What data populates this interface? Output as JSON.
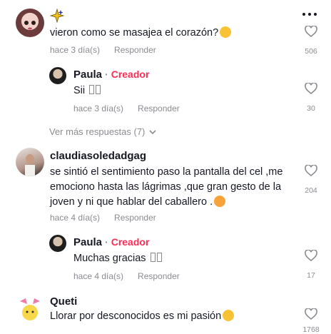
{
  "comments": [
    {
      "username": "",
      "text": "vieron como se masajea el corazón?",
      "time": "hace 3 día(s)",
      "reply_label": "Responder",
      "likes": "506"
    },
    {
      "username": "Paula",
      "creator_label": "Creador",
      "text": "Sii",
      "time": "hace 3 día(s)",
      "reply_label": "Responder",
      "likes": "30"
    },
    {
      "username": "claudiasoledadgag",
      "text_lines": [
        "se sintió el sentimiento paso la pantalla del cel ,me",
        "emociono hasta las lágrimas ,que gran gesto de la",
        "joven y ni que hablar del caballero ."
      ],
      "time": "hace 4 día(s)",
      "reply_label": "Responder",
      "likes": "204"
    },
    {
      "username": "Paula",
      "creator_label": "Creador",
      "text": "Muchas gracias",
      "time": "hace 4 día(s)",
      "reply_label": "Responder",
      "likes": "17"
    },
    {
      "username": "Queti",
      "text": "Llorar por desconocidos es mi pasión",
      "likes": "1768"
    }
  ],
  "view_more": "Ver más respuestas (7)",
  "colors": {
    "creator": "#fe2c55",
    "secondary": "#8a8b91",
    "text": "#161823"
  }
}
